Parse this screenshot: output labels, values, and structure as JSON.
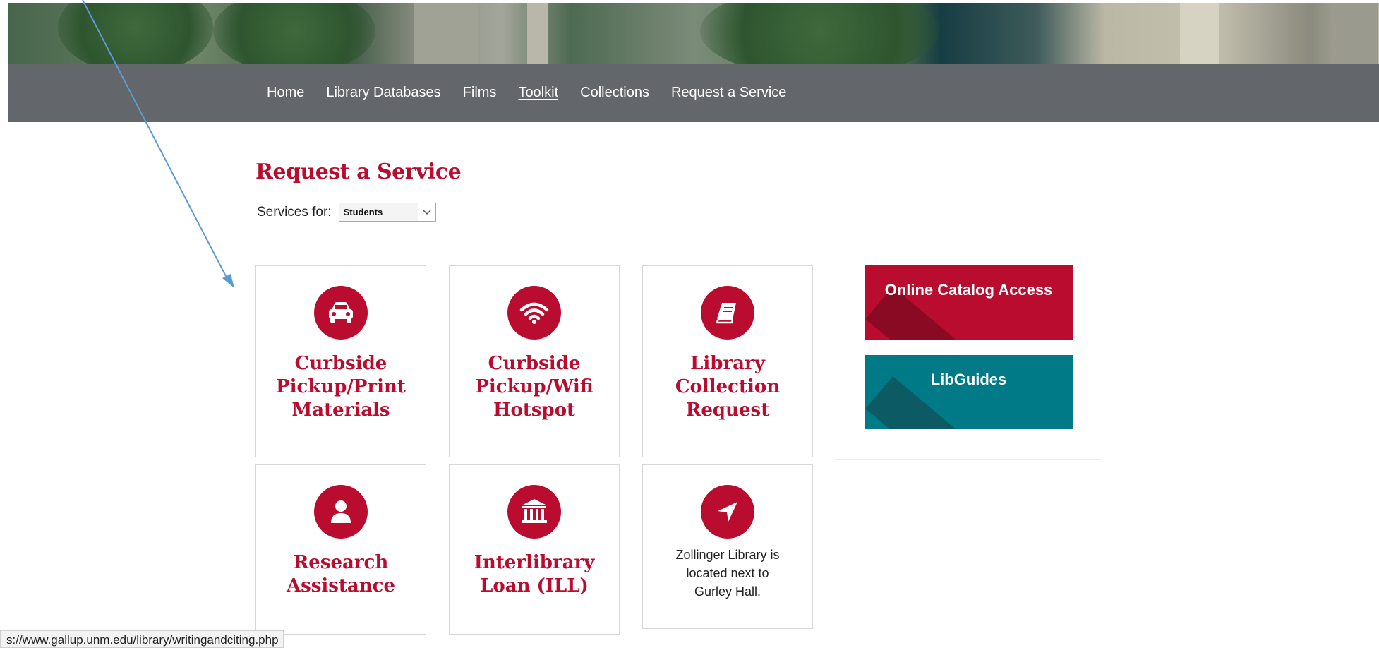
{
  "nav": {
    "items": [
      {
        "label": "Home",
        "active": false
      },
      {
        "label": "Library Databases",
        "active": false
      },
      {
        "label": "Films",
        "active": false
      },
      {
        "label": "Toolkit",
        "active": true
      },
      {
        "label": "Collections",
        "active": false
      },
      {
        "label": "Request a Service",
        "active": false
      }
    ]
  },
  "page": {
    "title": "Request a Service",
    "services_label": "Services for:",
    "services_selected": "Students"
  },
  "cards": [
    {
      "icon": "car-icon",
      "title_lines": [
        "Curbside",
        "Pickup/Print",
        "Materials"
      ]
    },
    {
      "icon": "wifi-icon",
      "title_lines": [
        "Curbside",
        "Pickup/Wifi",
        "Hotspot"
      ]
    },
    {
      "icon": "book-icon",
      "title_lines": [
        "Library",
        "Collection",
        "Request"
      ]
    },
    {
      "icon": "person-icon",
      "title_lines": [
        "Research",
        "Assistance"
      ]
    },
    {
      "icon": "bank-icon",
      "title_lines": [
        "Interlibrary",
        "Loan (ILL)"
      ]
    },
    {
      "icon": "location-arrow-icon",
      "note_lines": [
        "Zollinger Library is",
        "located next to",
        "Gurley Hall."
      ]
    }
  ],
  "promos": {
    "catalog": "Online Catalog Access",
    "libguides": "LibGuides"
  },
  "status_url": "s://www.gallup.unm.edu/library/writingandciting.php",
  "colors": {
    "brand_red": "#ba0c2f",
    "nav_gray": "#63666a",
    "teal": "#007a86",
    "annotation_arrow": "#5b9bd5"
  }
}
